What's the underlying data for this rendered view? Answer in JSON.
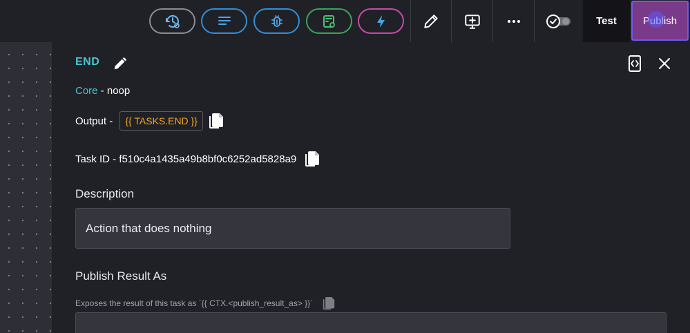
{
  "toolbar": {
    "pills": [
      {
        "icon": "history-settings-icon",
        "color": "#8b8c94"
      },
      {
        "icon": "lines-icon",
        "color": "#2f8fd8"
      },
      {
        "icon": "bug-icon",
        "color": "#2f8fd8"
      },
      {
        "icon": "table-link-icon",
        "color": "#3aa35a"
      },
      {
        "icon": "lightning-icon",
        "color": "#c74aa8"
      }
    ],
    "tools": [
      "pencil-icon",
      "add-screen-icon",
      "more-icon",
      "check-toggle-icon"
    ],
    "test_label": "Test",
    "publish_label": "Publish"
  },
  "panel": {
    "title": "END",
    "core_label": "Core",
    "core_sep": " - ",
    "core_value": "noop",
    "output_label": "Output - ",
    "output_value": "{{ TASKS.END }}",
    "task_id_label": "Task ID - ",
    "task_id_value": "f510c4a1435a49b8bf0c6252ad5828a9",
    "description_label": "Description",
    "description_value": "Action that does nothing",
    "publish_result_label": "Publish Result As",
    "publish_result_hint": "Exposes the result of this task as `{{ CTX.<publish_result_as> }}`"
  },
  "colors": {
    "accent_teal": "#47c6d0",
    "output_orange": "#f5a524",
    "publish_bg": "#7a3a8a"
  }
}
